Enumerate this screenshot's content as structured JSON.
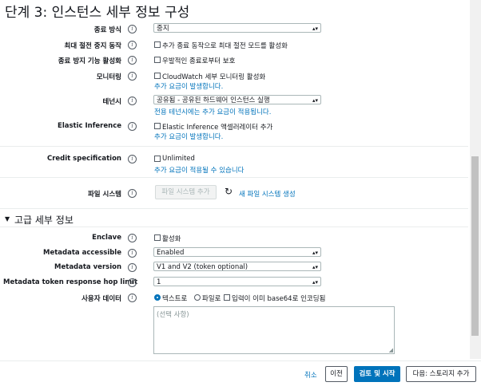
{
  "page": {
    "title": "단계 3: 인스턴스 세부 정보 구성"
  },
  "shutdown": {
    "label": "종료 방식",
    "value": "중지"
  },
  "stop_protect": {
    "label": "최대 절전 중지 동작",
    "checkbox": "추가 종료 동작으로 최대 절전 모드를 활성화"
  },
  "term_protect": {
    "label": "종료 방지 기능 활성화",
    "checkbox": "우발적인 종료로부터 보호"
  },
  "monitoring": {
    "label": "모니터링",
    "checkbox": "CloudWatch 세부 모니터링 활성화",
    "note": "추가 요금이 발생합니다."
  },
  "tenancy": {
    "label": "테넌시",
    "value": "공유됨 - 공유된 하드웨어 인스턴스 실행",
    "note": "전용 테넌시에는 추가 요금이 적용됩니다."
  },
  "elastic": {
    "label": "Elastic Inference",
    "checkbox": "Elastic Inference 액셀러레이터 추가",
    "note": "추가 요금이 발생합니다."
  },
  "credit": {
    "label": "Credit specification",
    "checkbox": "Unlimited",
    "note": "추가 요금이 적용될 수 있습니다"
  },
  "filesys": {
    "label": "파일 시스템",
    "add_button": "파일 시스템 추가",
    "create_link": "새 파일 시스템 생성"
  },
  "advanced": {
    "heading": "고급 세부 정보"
  },
  "enclave": {
    "label": "Enclave",
    "checkbox": "활성화"
  },
  "meta_access": {
    "label": "Metadata accessible",
    "value": "Enabled"
  },
  "meta_version": {
    "label": "Metadata version",
    "value": "V1 and V2 (token optional)"
  },
  "meta_hop": {
    "label": "Metadata token response hop limit",
    "value": "1"
  },
  "userdata": {
    "label": "사용자 데이터",
    "opt_text": "텍스트로",
    "opt_file": "파일로",
    "opt_b64": "입력이 이미 base64로 인코딩됨",
    "placeholder": "(선택 사항)"
  },
  "footer": {
    "cancel": "취소",
    "prev": "이전",
    "review": "검토 및 시작",
    "next": "다음: 스토리지 추가"
  }
}
